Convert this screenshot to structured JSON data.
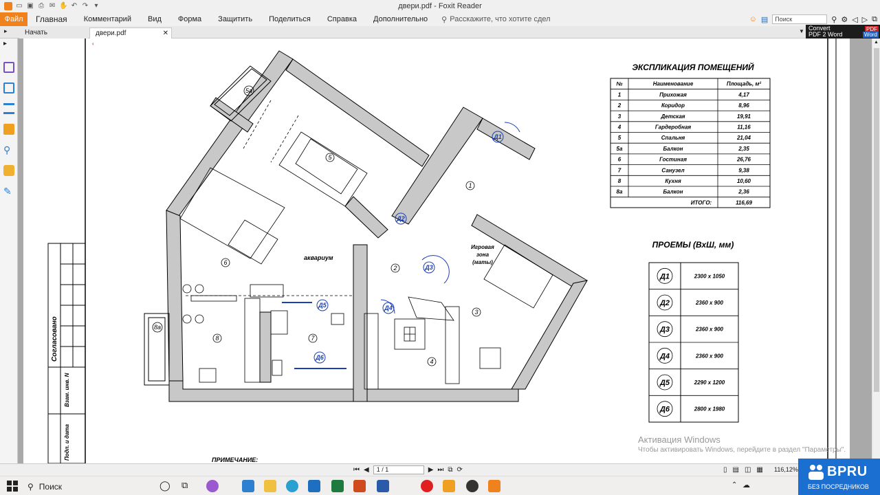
{
  "window": {
    "title": "двери.pdf - Foxit Reader"
  },
  "menu": {
    "file": "Файл",
    "items": [
      "Главная",
      "Комментарий",
      "Вид",
      "Форма",
      "Защитить",
      "Поделиться",
      "Справка",
      "Дополнительно"
    ],
    "tell_me": "Расскажите, что хотите сдел",
    "search_placeholder": "Поиск"
  },
  "tabs": {
    "start": "Начать",
    "doc": "двери.pdf"
  },
  "convert": {
    "line1": "Convert",
    "line2": "PDF 2 Word",
    "badge_pdf": "PDF",
    "badge_word": "Word"
  },
  "plan": {
    "explication_title": "ЭКСПЛИКАЦИЯ ПОМЕЩЕНИЙ",
    "explication_headers": [
      "№",
      "Наименование",
      "Площадь, м²"
    ],
    "explication_rows": [
      [
        "1",
        "Прихожая",
        "4,17"
      ],
      [
        "2",
        "Коридор",
        "8,96"
      ],
      [
        "3",
        "Детская",
        "19,91"
      ],
      [
        "4",
        "Гардеробная",
        "11,16"
      ],
      [
        "5",
        "Спальня",
        "21,04"
      ],
      [
        "5а",
        "Балкон",
        "2,35"
      ],
      [
        "6",
        "Гостиная",
        "26,76"
      ],
      [
        "7",
        "Санузел",
        "9,38"
      ],
      [
        "8",
        "Кухня",
        "10,60"
      ],
      [
        "8а",
        "Балкон",
        "2,36"
      ]
    ],
    "explication_total_label": "ИТОГО:",
    "explication_total_value": "116,69",
    "openings_title": "ПРОЕМЫ (ВхШ, мм)",
    "openings": [
      [
        "Д1",
        "2300 x 1050"
      ],
      [
        "Д2",
        "2360 x 900"
      ],
      [
        "Д3",
        "2360 x 900"
      ],
      [
        "Д4",
        "2360 x 900"
      ],
      [
        "Д5",
        "2290 x 1200"
      ],
      [
        "Д6",
        "2800 x 1980"
      ]
    ],
    "room_labels": [
      "1",
      "2",
      "3",
      "4",
      "5",
      "5а",
      "6",
      "7",
      "8",
      "8а"
    ],
    "door_labels": [
      "Д1",
      "Д2",
      "Д3",
      "Д4",
      "Д5",
      "Д6"
    ],
    "aquarium": "аквариум",
    "play_zone": [
      "Игровая",
      "зона",
      "(маты)"
    ],
    "stamp_vertical": [
      "Согласовано",
      "Взам. инв. N",
      "Подп. и дата"
    ],
    "note": "ПРИМЕЧАНИЕ:"
  },
  "status": {
    "page": "1 / 1",
    "zoom": "116,12%"
  },
  "activation": {
    "line1": "Активация Windows",
    "line2": "Чтобы активировать Windows, перейдите в раздел \"Параметры\"."
  },
  "watermark": {
    "name": "BPRU",
    "sub": "БЕЗ ПОСРЕДНИКОВ"
  },
  "taskbar": {
    "search": "Поиск"
  }
}
